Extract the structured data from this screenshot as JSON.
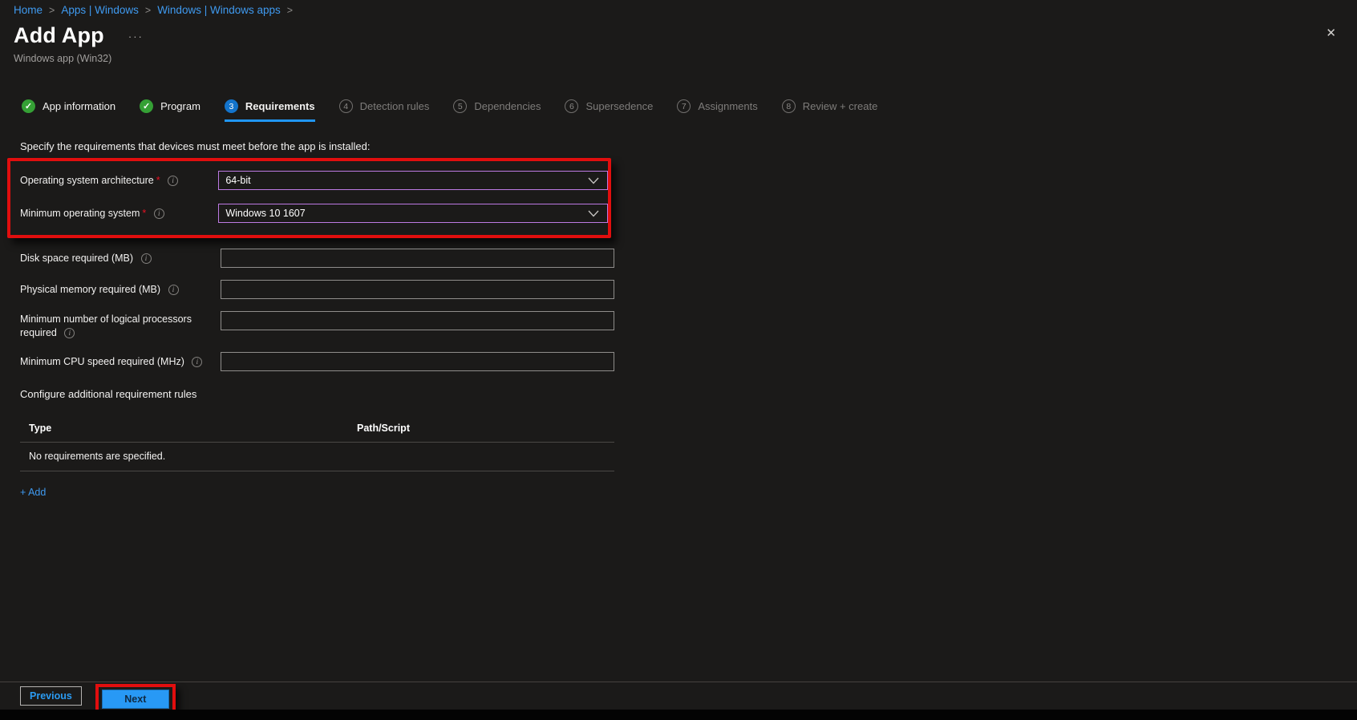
{
  "colors": {
    "background": "#1b1a19",
    "link_blue": "#3f9af0",
    "accent_blue": "#2899f5",
    "annotation_red": "#e10e0e",
    "dropdown_focus_border": "#bd7ae3",
    "step_done_green": "#35a035",
    "step_active_blue": "#1374cc",
    "muted_text": "#a19f9d"
  },
  "breadcrumb": {
    "separator": ">",
    "items": [
      "Home",
      "Apps | Windows",
      "Windows | Windows apps"
    ]
  },
  "header": {
    "title": "Add App",
    "ellipsis": "···",
    "subtitle": "Windows app (Win32)",
    "close_icon": "✕"
  },
  "wizard": {
    "steps": [
      {
        "label": "App information",
        "state": "done",
        "marker": "✓"
      },
      {
        "label": "Program",
        "state": "done",
        "marker": "✓"
      },
      {
        "label": "Requirements",
        "state": "active",
        "marker": "3"
      },
      {
        "label": "Detection rules",
        "state": "upcoming",
        "marker": "4"
      },
      {
        "label": "Dependencies",
        "state": "upcoming",
        "marker": "5"
      },
      {
        "label": "Supersedence",
        "state": "upcoming",
        "marker": "6"
      },
      {
        "label": "Assignments",
        "state": "upcoming",
        "marker": "7"
      },
      {
        "label": "Review + create",
        "state": "upcoming",
        "marker": "8"
      }
    ]
  },
  "form": {
    "intro": "Specify the requirements that devices must meet before the app is installed:",
    "required_marker": "*",
    "info_icon": "i",
    "fields": [
      {
        "label": "Operating system architecture",
        "required": true,
        "type": "dropdown",
        "value": "64-bit"
      },
      {
        "label": "Minimum operating system",
        "required": true,
        "type": "dropdown",
        "value": "Windows 10 1607"
      },
      {
        "label": "Disk space required (MB)",
        "required": false,
        "type": "text",
        "value": ""
      },
      {
        "label": "Physical memory required (MB)",
        "required": false,
        "type": "text",
        "value": ""
      },
      {
        "label": "Minimum number of logical processors required",
        "required": false,
        "type": "text",
        "value": ""
      },
      {
        "label": "Minimum CPU speed required (MHz)",
        "required": false,
        "type": "text",
        "value": ""
      }
    ]
  },
  "rules_section": {
    "heading": "Configure additional requirement rules",
    "table": {
      "columns": [
        "Type",
        "Path/Script"
      ],
      "empty_message": "No requirements are specified."
    },
    "add_link": "+ Add"
  },
  "footer": {
    "previous_label": "Previous",
    "next_label": "Next"
  }
}
